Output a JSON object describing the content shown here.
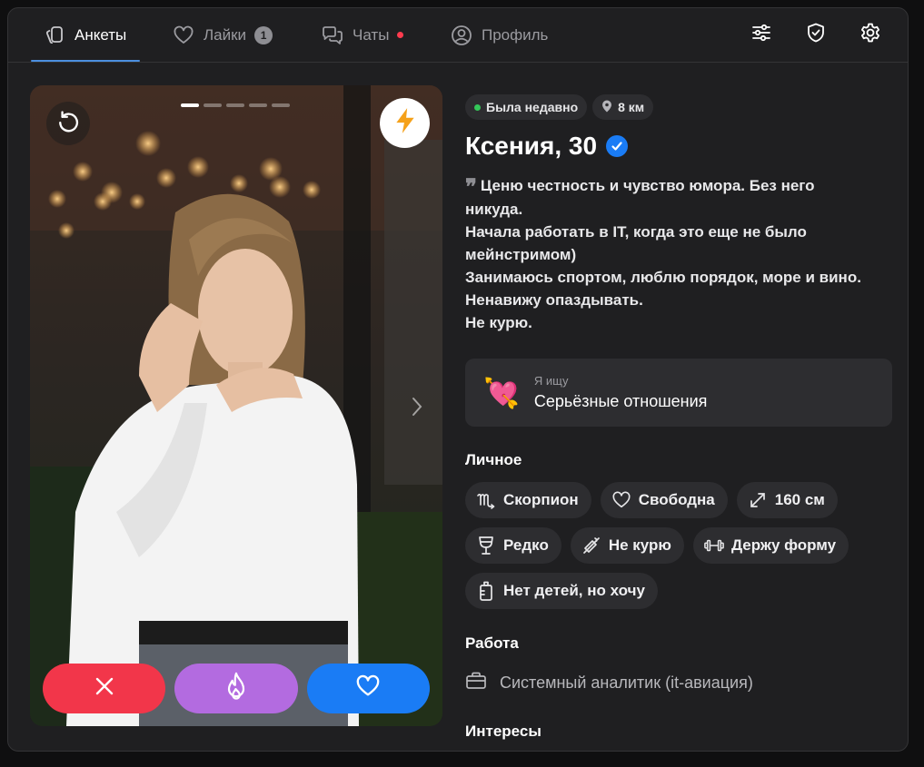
{
  "nav": {
    "tabs": [
      {
        "label": "Анкеты",
        "icon": "cards-icon",
        "active": true
      },
      {
        "label": "Лайки",
        "icon": "heart-outline-icon",
        "badge": "1"
      },
      {
        "label": "Чаты",
        "icon": "chat-bubbles-icon",
        "unread_dot": true
      },
      {
        "label": "Профиль",
        "icon": "user-circle-icon"
      }
    ],
    "right_icons": [
      "filters-icon",
      "shield-check-icon",
      "gear-icon"
    ],
    "accent": "#4b8fe0"
  },
  "photo": {
    "pages_total": 5,
    "current_page": 1,
    "buttons": [
      "rewind-icon",
      "lightning-icon",
      "chevron-right-icon"
    ],
    "actions": [
      {
        "name": "dislike",
        "icon": "close-icon",
        "color": "#f2364a"
      },
      {
        "name": "superlike",
        "icon": "flame-icon",
        "color": "#b36be0"
      },
      {
        "name": "like",
        "icon": "heart-outline-icon",
        "color": "#1a7cf5"
      }
    ]
  },
  "profile": {
    "status": "Была недавно",
    "distance": "8 км",
    "name_age": "Ксения, 30",
    "verified": true,
    "bio_lines": [
      "Ценю честность и чувство юмора. Без него",
      "никуда.",
      "Начала работать в IT, когда это еще не было",
      "мейнстримом)",
      "Занимаюсь спортом, люблю порядок, море и вино.",
      "Ненавижу опаздывать.",
      "Не курю."
    ],
    "looking_for": {
      "label": "Я ищу",
      "value": "Серьёзные отношения",
      "emoji": "💘"
    },
    "personal_title": "Личное",
    "personal_tags": [
      {
        "label": "Скорпион",
        "icon": "scorpio-icon"
      },
      {
        "label": "Свободна",
        "icon": "heart-outline-icon"
      },
      {
        "label": "160 см",
        "icon": "expand-arrows-icon"
      },
      {
        "label": "Редко",
        "icon": "wine-glass-icon"
      },
      {
        "label": "Не курю",
        "icon": "no-smoking-icon"
      },
      {
        "label": "Держу форму",
        "icon": "dumbbell-icon"
      },
      {
        "label": "Нет детей, но хочу",
        "icon": "baby-bottle-icon"
      }
    ],
    "work_title": "Работа",
    "work": {
      "label": "Системный аналитик (it-авиация)",
      "icon": "briefcase-icon"
    },
    "interests_title": "Интересы"
  }
}
